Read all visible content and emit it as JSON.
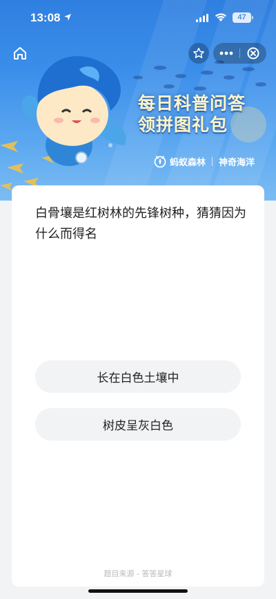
{
  "status_bar": {
    "time": "13:08",
    "battery": "47",
    "icons": [
      "location-arrow-icon",
      "signal-icon",
      "wifi-icon",
      "battery-icon"
    ]
  },
  "nav": {
    "icons": [
      "home-icon",
      "star-icon",
      "more-icon",
      "close-icon"
    ]
  },
  "banner": {
    "title_line1": "每日科普问答",
    "title_line2": "领拼图礼包",
    "brand_name": "蚂蚁森林",
    "brand_partner": "神奇海洋",
    "colors": {
      "sky": "#3b8eea",
      "title": "#fff6c8"
    }
  },
  "quiz": {
    "question": "白骨壤是红树林的先锋树种，猜猜因为什么而得名",
    "options": [
      "长在白色土壤中",
      "树皮呈灰白色"
    ],
    "source": "题目来源 - 答答星球"
  }
}
